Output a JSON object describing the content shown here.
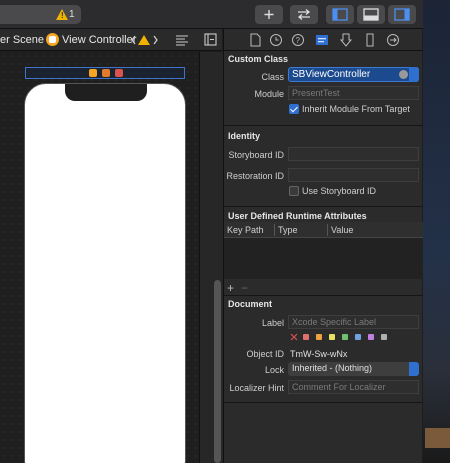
{
  "toolbar": {
    "warning_count": "1",
    "buttons": [
      "add-library-icon",
      "code-review-icon",
      "left-panel-icon",
      "bottom-panel-icon",
      "right-panel-icon"
    ]
  },
  "jumpbar": {
    "scene_crumb": "er Scene",
    "vc_crumb": "View Controller"
  },
  "inspector": {
    "tabs": [
      "file-icon",
      "history-icon",
      "help-icon",
      "identity-icon",
      "attributes-icon",
      "size-icon",
      "connections-icon"
    ],
    "custom_class": {
      "title": "Custom Class",
      "class_label": "Class",
      "class_value": "SBViewController",
      "module_label": "Module",
      "module_placeholder": "PresentTest",
      "inherit_label": "Inherit Module From Target"
    },
    "identity": {
      "title": "Identity",
      "storyboard_id_label": "Storyboard ID",
      "restoration_id_label": "Restoration ID",
      "use_storyboard_id_label": "Use Storyboard ID"
    },
    "runtime_attrs": {
      "title": "User Defined Runtime Attributes",
      "col_key_path": "Key Path",
      "col_type": "Type",
      "col_value": "Value",
      "add": "+",
      "remove": "−"
    },
    "document": {
      "title": "Document",
      "label_label": "Label",
      "label_placeholder": "Xcode Specific Label",
      "object_id_label": "Object ID",
      "object_id_value": "TmW-Sw-wNx",
      "lock_label": "Lock",
      "lock_value": "Inherited - (Nothing)",
      "localizer_label": "Localizer Hint",
      "localizer_placeholder": "Comment For Localizer"
    },
    "colors": {
      "accent": "#2f6fd0",
      "swatches": [
        "#e07070",
        "#f0a040",
        "#e8e060",
        "#70c070",
        "#70a0e0",
        "#c080e0",
        "#b0b0b0"
      ]
    }
  }
}
